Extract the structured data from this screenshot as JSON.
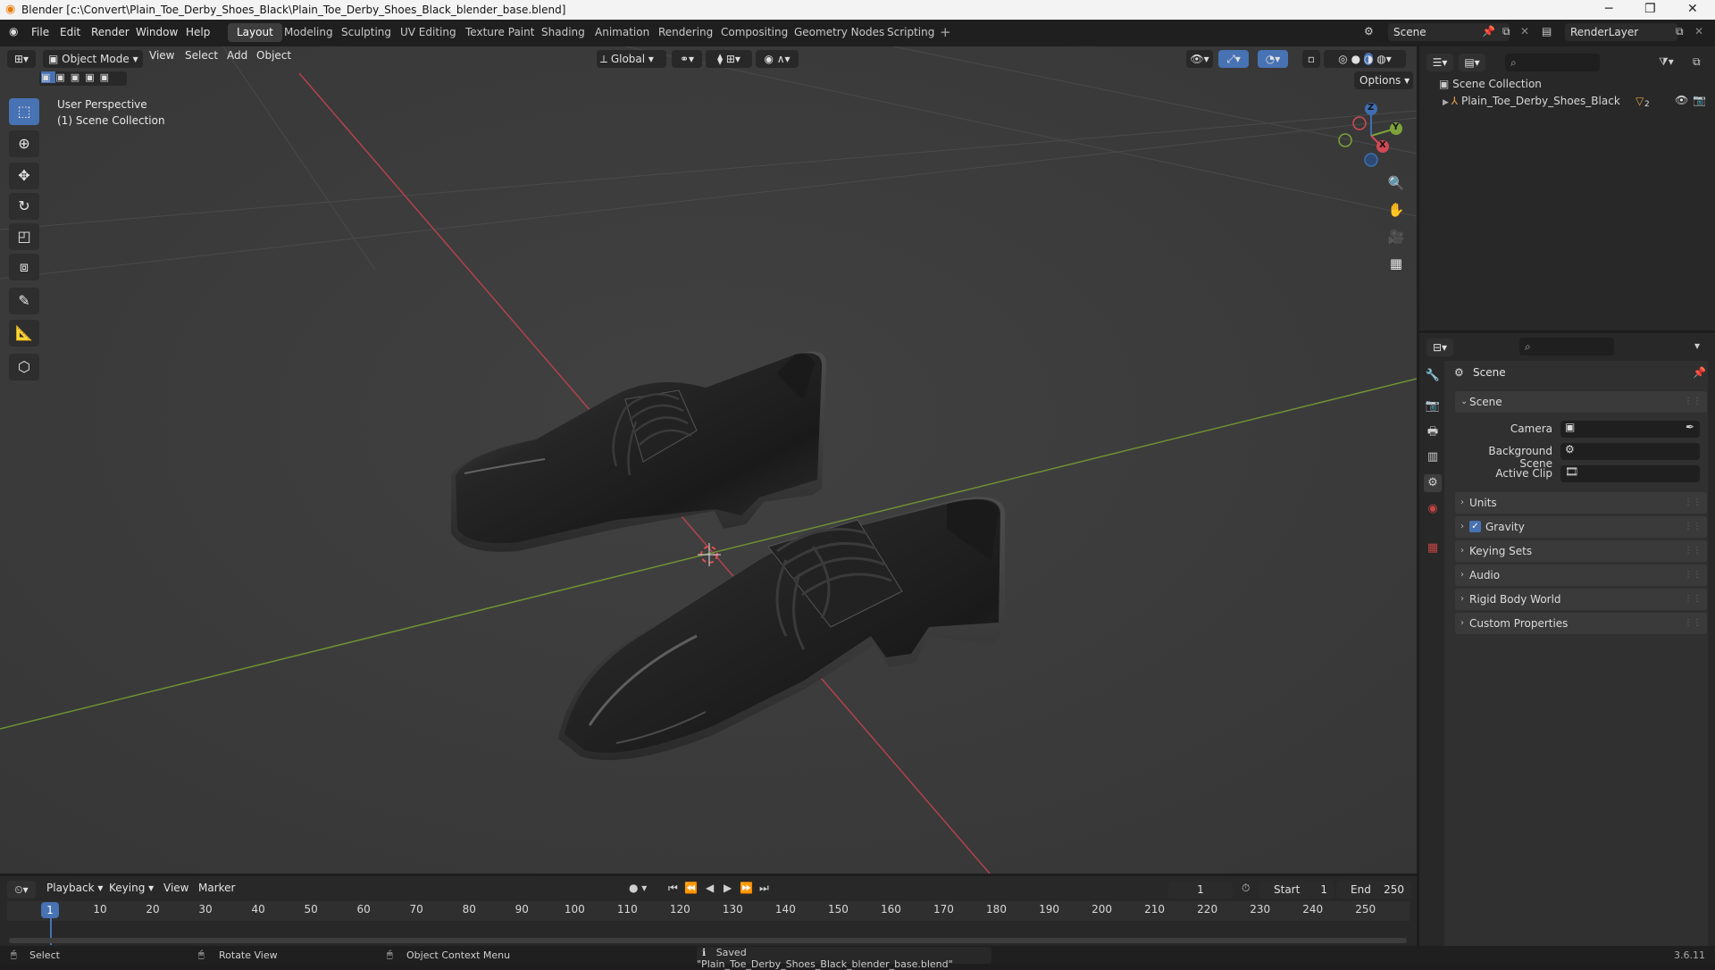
{
  "window": {
    "title": "Blender [c:\\Convert\\Plain_Toe_Derby_Shoes_Black\\Plain_Toe_Derby_Shoes_Black_blender_base.blend]",
    "minimize": "─",
    "maximize": "❐",
    "close": "✕"
  },
  "menu": {
    "file": "File",
    "edit": "Edit",
    "render": "Render",
    "window": "Window",
    "help": "Help"
  },
  "workspaces": [
    "Layout",
    "Modeling",
    "Sculpting",
    "UV Editing",
    "Texture Paint",
    "Shading",
    "Animation",
    "Rendering",
    "Compositing",
    "Geometry Nodes",
    "Scripting"
  ],
  "workspace_add": "+",
  "scene_field": "Scene",
  "renderlayer_field": "RenderLayer",
  "viewport_header": {
    "mode": "Object Mode",
    "view": "View",
    "select": "Select",
    "add": "Add",
    "object": "Object",
    "orientation": "Global",
    "options": "Options"
  },
  "viewport": {
    "perspective": "User Perspective",
    "collection": "(1) Scene Collection",
    "gizmo": {
      "x": "X",
      "y": "Y",
      "z": "Z"
    }
  },
  "outliner": {
    "scene_collection": "Scene Collection",
    "object_name": "Plain_Toe_Derby_Shoes_Black",
    "object_badge": "2"
  },
  "properties": {
    "header": "Scene",
    "section_scene": "Scene",
    "camera_label": "Camera",
    "background_scene_label": "Background Scene",
    "active_clip_label": "Active Clip",
    "panels": [
      "Units",
      "Gravity",
      "Keying Sets",
      "Audio",
      "Rigid Body World",
      "Custom Properties"
    ],
    "gravity_checked": true
  },
  "timeline": {
    "playback": "Playback",
    "keying": "Keying",
    "view": "View",
    "marker": "Marker",
    "current_frame": "1",
    "start_label": "Start",
    "start_value": "1",
    "end_label": "End",
    "end_value": "250",
    "frame_marker": "1",
    "ticks": [
      "10",
      "20",
      "30",
      "40",
      "50",
      "60",
      "70",
      "80",
      "90",
      "100",
      "110",
      "120",
      "130",
      "140",
      "150",
      "160",
      "170",
      "180",
      "190",
      "200",
      "210",
      "220",
      "230",
      "240",
      "250"
    ]
  },
  "status": {
    "select": "Select",
    "rotate": "Rotate View",
    "context": "Object Context Menu",
    "message": "Saved \"Plain_Toe_Derby_Shoes_Black_blender_base.blend\"",
    "version": "3.6.11"
  },
  "colors": {
    "accent": "#4772b3",
    "viewport_bg": "#3d3d3d",
    "x_axis": "#d24a55",
    "y_axis": "#7ea33a"
  }
}
